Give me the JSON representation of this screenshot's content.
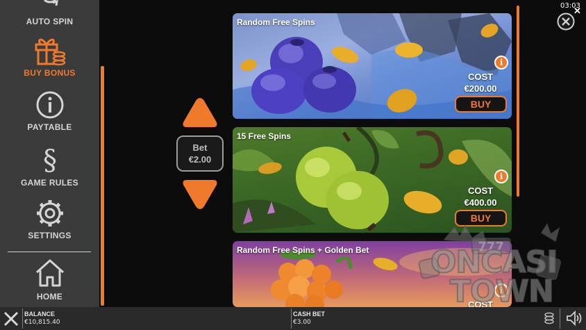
{
  "sidebar": {
    "items": [
      {
        "key": "auto_spin",
        "label": "AUTO SPIN",
        "icon": "auto-spin-icon"
      },
      {
        "key": "buy_bonus",
        "label": "BUY BONUS",
        "icon": "gift-coins-icon",
        "active": true
      },
      {
        "key": "paytable",
        "label": "PAYTABLE",
        "icon": "info-circle-icon"
      },
      {
        "key": "game_rules",
        "label": "GAME RULES",
        "icon": "section-sign-icon"
      },
      {
        "key": "settings",
        "label": "SETTINGS",
        "icon": "gear-icon"
      },
      {
        "key": "home",
        "label": "HOME",
        "icon": "home-icon"
      }
    ]
  },
  "bet": {
    "label": "Bet",
    "value": "€2.00"
  },
  "cards": [
    {
      "title": "Random Free Spins",
      "cost_label": "COST",
      "cost": "€200.00",
      "buy_label": "BUY"
    },
    {
      "title": "15 Free Spins",
      "cost_label": "COST",
      "cost": "€400.00",
      "buy_label": "BUY"
    },
    {
      "title": "Random Free Spins + Golden Bet",
      "cost_label": "COST"
    }
  ],
  "clock": "03:03",
  "bottom": {
    "balance_label": "BALANCE",
    "balance_value": "€10,815.40",
    "cashbet_label": "CASH BET",
    "cashbet_value": "€3.00"
  },
  "watermark": {
    "line1": "ONCASI",
    "line2": "TOWN"
  },
  "colors": {
    "accent": "#f07a2c",
    "sidebar_bg": "#3b3b3b",
    "bottom_bg": "#2a2a2a"
  }
}
